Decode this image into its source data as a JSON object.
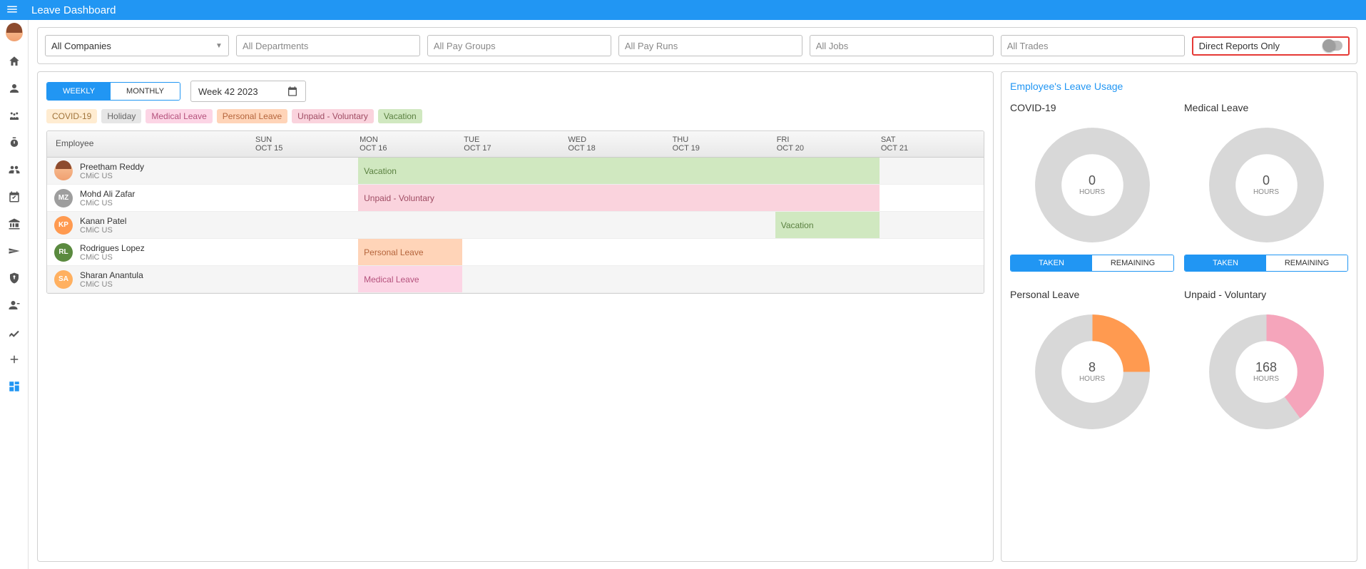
{
  "header": {
    "title": "Leave Dashboard"
  },
  "filters": {
    "companies": "All Companies",
    "departments_ph": "All Departments",
    "paygroups_ph": "All Pay Groups",
    "payruns_ph": "All Pay Runs",
    "jobs_ph": "All Jobs",
    "trades_ph": "All Trades",
    "direct_reports_label": "Direct Reports Only"
  },
  "view": {
    "weekly": "WEEKLY",
    "monthly": "MONTHLY",
    "date_label": "Week 42 2023"
  },
  "legend": {
    "covid": "COVID-19",
    "holiday": "Holiday",
    "medical": "Medical Leave",
    "personal": "Personal Leave",
    "unpaid": "Unpaid - Voluntary",
    "vacation": "Vacation"
  },
  "grid": {
    "header_emp": "Employee",
    "days": [
      {
        "name": "SUN",
        "date": "OCT 15"
      },
      {
        "name": "MON",
        "date": "OCT 16"
      },
      {
        "name": "TUE",
        "date": "OCT 17"
      },
      {
        "name": "WED",
        "date": "OCT 18"
      },
      {
        "name": "THU",
        "date": "OCT 19"
      },
      {
        "name": "FRI",
        "date": "OCT 20"
      },
      {
        "name": "SAT",
        "date": "OCT 21"
      }
    ],
    "rows": [
      {
        "name": "Preetham Reddy",
        "company": "CMiC US",
        "avatar": "pr",
        "initials": "",
        "leave": {
          "type": "vacation",
          "label": "Vacation",
          "start": 1,
          "span": 5
        }
      },
      {
        "name": "Mohd Ali Zafar",
        "company": "CMiC US",
        "avatar": "mz",
        "initials": "MZ",
        "leave": {
          "type": "unpaid",
          "label": "Unpaid - Voluntary",
          "start": 1,
          "span": 5
        }
      },
      {
        "name": "Kanan Patel",
        "company": "CMiC US",
        "avatar": "kp",
        "initials": "KP",
        "leave": {
          "type": "vacation",
          "label": "Vacation",
          "start": 5,
          "span": 1
        }
      },
      {
        "name": "Rodrigues Lopez",
        "company": "CMiC US",
        "avatar": "rl",
        "initials": "RL",
        "leave": {
          "type": "personal",
          "label": "Personal Leave",
          "start": 1,
          "span": 1
        }
      },
      {
        "name": "Sharan Anantula",
        "company": "CMiC US",
        "avatar": "sa",
        "initials": "SA",
        "leave": {
          "type": "medical",
          "label": "Medical Leave",
          "start": 1,
          "span": 1
        }
      }
    ]
  },
  "usage": {
    "title": "Employee's Leave Usage",
    "tab_taken": "TAKEN",
    "tab_remaining": "REMAINING",
    "items": [
      {
        "title": "COVID-19",
        "value": "0",
        "unit": "HOURS",
        "pct": 0,
        "color": "#c0c0c0"
      },
      {
        "title": "Medical Leave",
        "value": "0",
        "unit": "HOURS",
        "pct": 0,
        "color": "#c0c0c0"
      },
      {
        "title": "Personal Leave",
        "value": "8",
        "unit": "HOURS",
        "pct": 25,
        "color": "#ff9a50"
      },
      {
        "title": "Unpaid - Voluntary",
        "value": "168",
        "unit": "HOURS",
        "pct": 40,
        "color": "#f5a5bb"
      }
    ]
  },
  "chart_data": [
    {
      "type": "pie",
      "title": "COVID-19",
      "series": [
        {
          "name": "Taken",
          "values": [
            0
          ]
        }
      ],
      "unit": "HOURS",
      "pct": 0
    },
    {
      "type": "pie",
      "title": "Medical Leave",
      "series": [
        {
          "name": "Taken",
          "values": [
            0
          ]
        }
      ],
      "unit": "HOURS",
      "pct": 0
    },
    {
      "type": "pie",
      "title": "Personal Leave",
      "series": [
        {
          "name": "Taken",
          "values": [
            8
          ]
        }
      ],
      "unit": "HOURS",
      "pct": 25
    },
    {
      "type": "pie",
      "title": "Unpaid - Voluntary",
      "series": [
        {
          "name": "Taken",
          "values": [
            168
          ]
        }
      ],
      "unit": "HOURS",
      "pct": 40
    }
  ]
}
